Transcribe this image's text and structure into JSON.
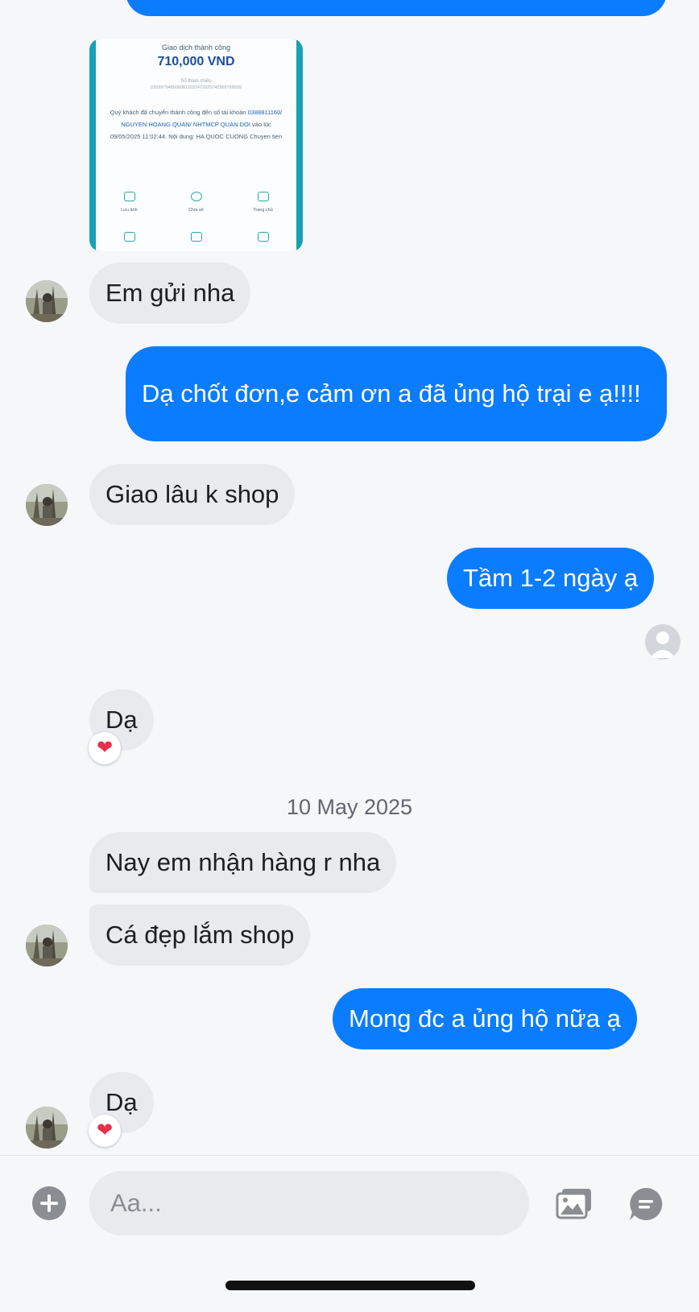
{
  "messages": {
    "top_partial": "",
    "em_gui_nha": "Em gửi nha",
    "da_chot_don": "Dạ chốt đơn,e cảm ơn a đã ủng hộ trại e ạ!!!!",
    "giao_lau": "Giao lâu k shop",
    "tam_1_2": "Tầm 1-2 ngày ạ",
    "da_1": "Dạ",
    "date_separator": "10 May 2025",
    "nay_em": "Nay em nhận hàng r nha",
    "ca_dep": "Cá đẹp lắm shop",
    "mong_dc": "Mong đc a ủng hộ nữa ạ",
    "da_2": "Dạ"
  },
  "receipt": {
    "title": "Giao dịch thành công",
    "amount": "710,000 VND",
    "ref_label": "Số tham chiếu",
    "ref_code": "0309970480000811031472025742566769509",
    "desc_prefix": "Quý khách đã chuyển thành công đến số tài khoản",
    "account": "0388811160/ NGUYEN HOANG QUAN/ NHTMCP QUAN DOI",
    "desc_time": "vào lúc 09/05/2025 11:02:44. Nội dung: HA QUOC CUONG Chuyen tien",
    "actions": [
      "Lưu ảnh",
      "Chia sẻ",
      "Trang chủ"
    ]
  },
  "reactions": {
    "heart": "❤"
  },
  "composer": {
    "placeholder": "Aa...",
    "add_icon": "plus-circle-icon",
    "gallery_icon": "photo-gallery-icon",
    "sticker_icon": "chat-sticker-icon"
  },
  "colors": {
    "outgoing_bubble": "#0a7cff",
    "incoming_bubble": "#e9eaee",
    "background": "#f6f7f9",
    "icon_gray": "#8a8d91"
  }
}
